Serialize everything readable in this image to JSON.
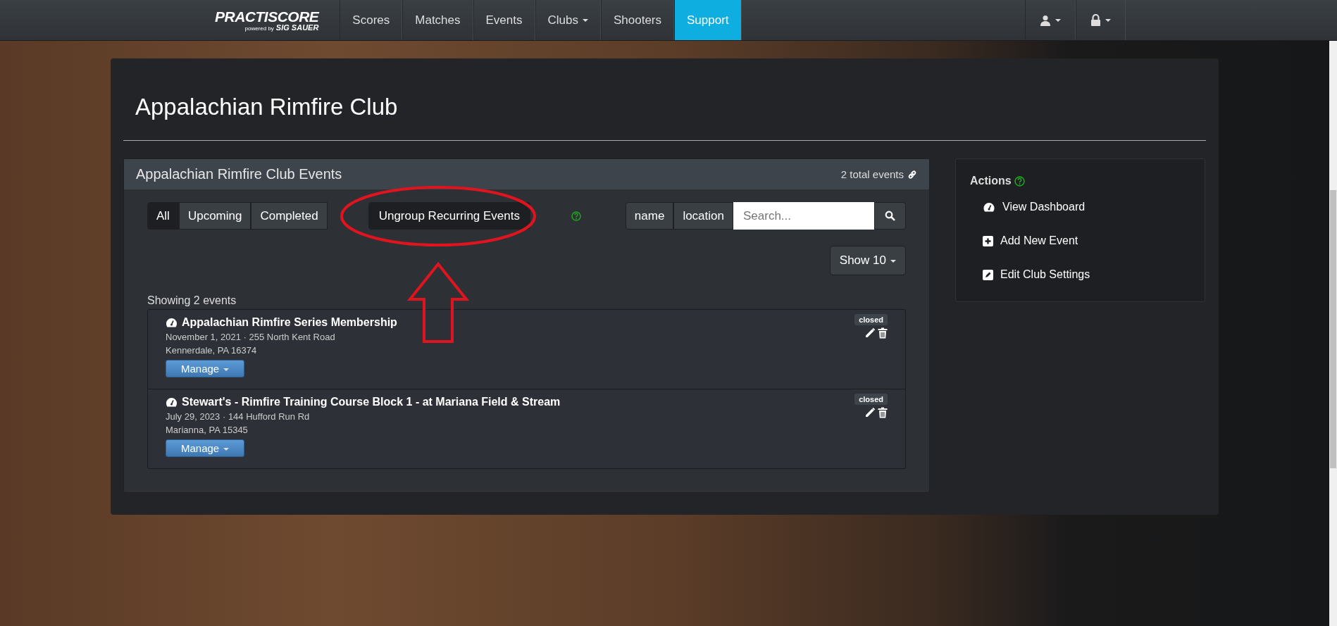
{
  "navbar": {
    "logo": {
      "brand": "PRACTISCORE",
      "tagline": "powered by",
      "tagline_brand": "SIG SAUER"
    },
    "items": [
      {
        "label": "Scores",
        "selected": false,
        "dropdown": false
      },
      {
        "label": "Matches",
        "selected": false,
        "dropdown": false
      },
      {
        "label": "Events",
        "selected": false,
        "dropdown": false
      },
      {
        "label": "Clubs",
        "selected": false,
        "dropdown": true
      },
      {
        "label": "Shooters",
        "selected": false,
        "dropdown": false
      },
      {
        "label": "Support",
        "selected": true,
        "dropdown": false
      }
    ]
  },
  "page": {
    "title": "Appalachian Rimfire Club"
  },
  "events_panel": {
    "title": "Appalachian Rimfire Club Events",
    "total": "2 total events",
    "filters": [
      {
        "label": "All",
        "selected": true
      },
      {
        "label": "Upcoming",
        "selected": false
      },
      {
        "label": "Completed",
        "selected": false
      }
    ],
    "ungroup_button": "Ungroup Recurring Events",
    "search_fields": [
      {
        "label": "name"
      },
      {
        "label": "location"
      }
    ],
    "search": {
      "placeholder": "Search..."
    },
    "page_size": "Show 10",
    "showing": "Showing 2 events",
    "events": [
      {
        "name": "Appalachian Rimfire Series Membership",
        "date_address": "November 1, 2021 · 255 North Kent Road",
        "city": "Kennerdale, PA 16374",
        "status": "closed",
        "manage": "Manage"
      },
      {
        "name": "Stewart's - Rimfire Training Course Block 1 - at Mariana Field & Stream",
        "date_address": "July 29, 2023 · 144 Hufford Run Rd",
        "city": "Marianna, PA 15345",
        "status": "closed",
        "manage": "Manage"
      }
    ]
  },
  "actions_panel": {
    "title": "Actions",
    "items": [
      {
        "kind": "dashboard",
        "label": "View Dashboard"
      },
      {
        "kind": "add",
        "label": "Add New Event"
      },
      {
        "kind": "edit",
        "label": "Edit Club Settings"
      }
    ]
  }
}
